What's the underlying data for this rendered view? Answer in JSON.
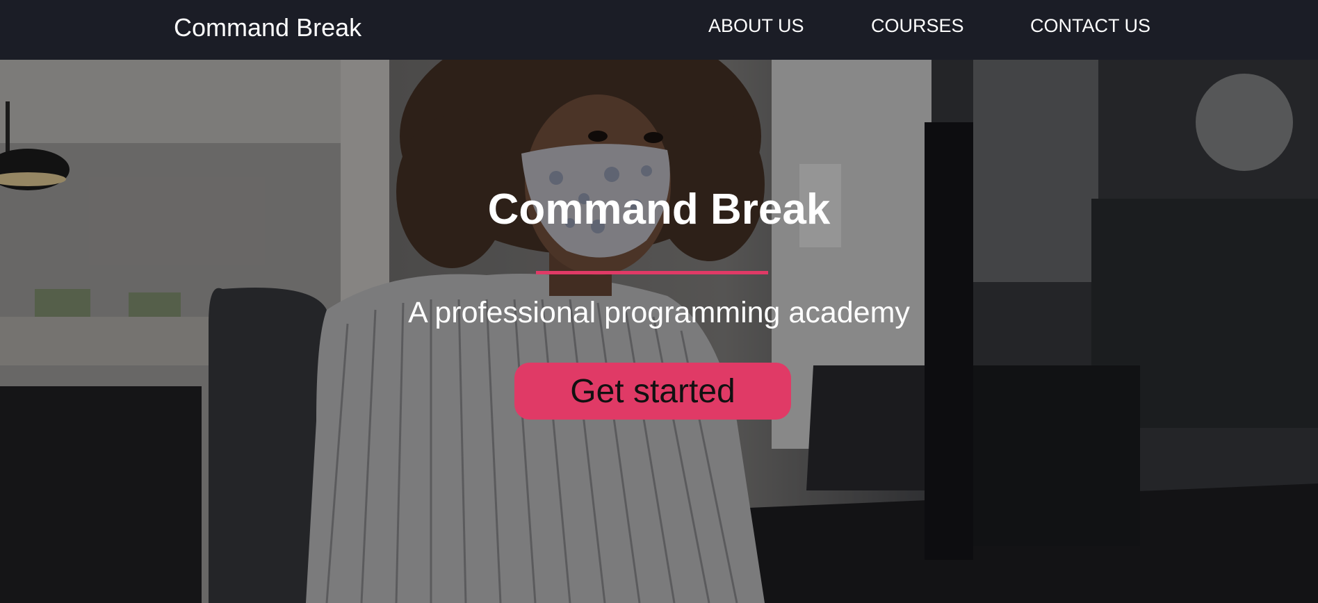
{
  "navbar": {
    "brand": "Command Break",
    "links": [
      {
        "label": "ABOUT US"
      },
      {
        "label": "COURSES"
      },
      {
        "label": "CONTACT US"
      }
    ]
  },
  "hero": {
    "title": "Command Break",
    "subtitle": "A professional programming academy",
    "cta_label": "Get started",
    "photo_icon": "woman-in-mask-at-desk-photo"
  },
  "colors": {
    "navbar_bg": "#1b1d26",
    "accent": "#e03a66",
    "text_light": "#ffffff"
  }
}
